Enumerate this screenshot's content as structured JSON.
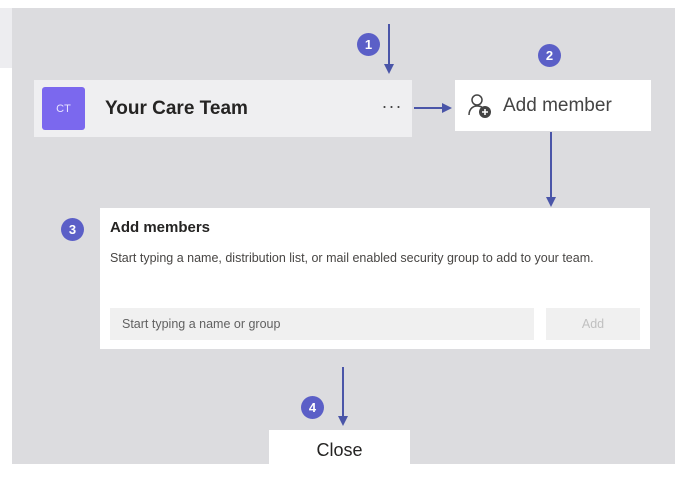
{
  "team": {
    "avatar_initials": "CT",
    "name": "Your Care Team",
    "more_label": "···"
  },
  "add_member": {
    "label": "Add member"
  },
  "dialog": {
    "title": "Add members",
    "description": "Start typing a name, distribution list, or mail enabled security group to add to your team.",
    "search_placeholder": "Start typing a name or group",
    "add_label": "Add"
  },
  "close": {
    "label": "Close"
  },
  "badges": [
    "1",
    "2",
    "3",
    "4"
  ],
  "colors": {
    "accent": "#5b5fc7",
    "avatar": "#7b68ee",
    "background": "#dcdcdf",
    "arrow": "#4a55a8"
  }
}
